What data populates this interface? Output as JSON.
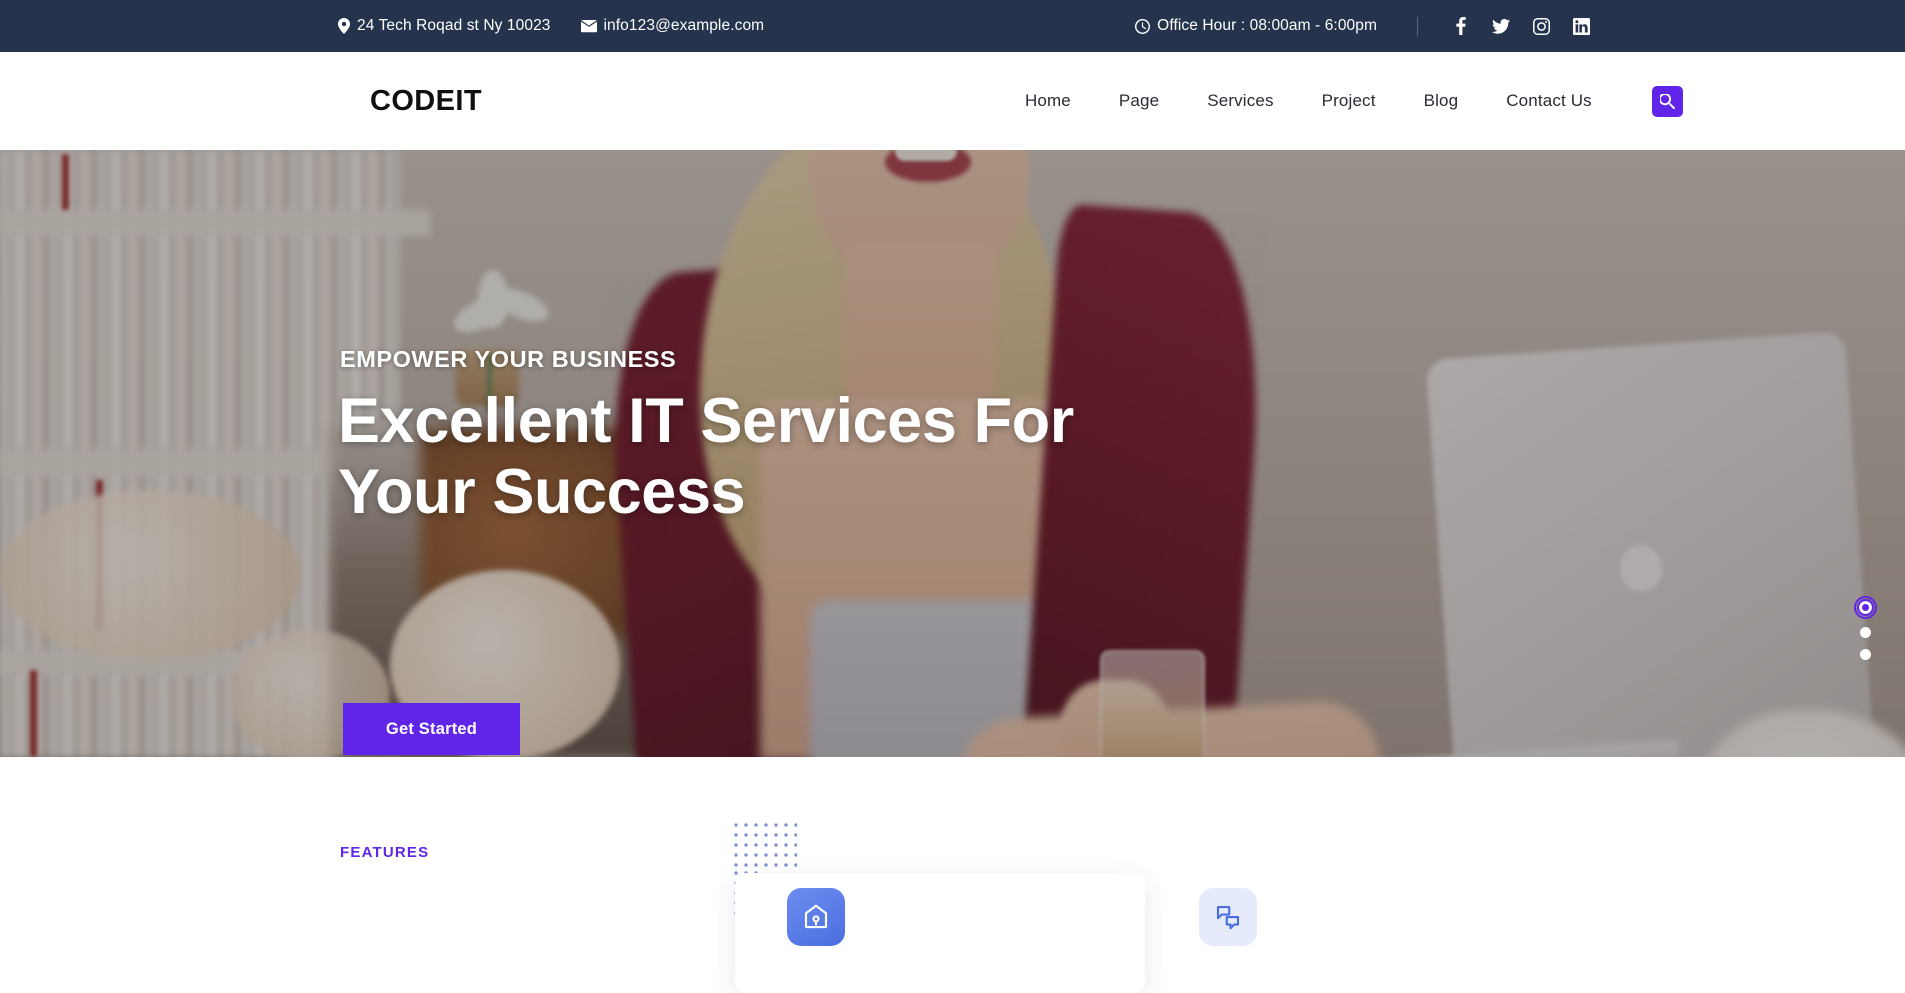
{
  "topbar": {
    "address": "24 Tech Roqad st Ny 10023",
    "address_icon": "map-pin-icon",
    "email": "info123@example.com",
    "email_icon": "envelope-icon",
    "office_hour": "Office Hour : 08:00am - 6:00pm",
    "office_hour_icon": "clock-icon",
    "socials": [
      {
        "name": "facebook-icon",
        "label": "Facebook"
      },
      {
        "name": "twitter-icon",
        "label": "Twitter"
      },
      {
        "name": "instagram-icon",
        "label": "Instagram"
      },
      {
        "name": "linkedin-icon",
        "label": "LinkedIn"
      }
    ],
    "background_color": "#26334d"
  },
  "header": {
    "logo": "CODEIT",
    "nav": [
      {
        "label": "Home"
      },
      {
        "label": "Page"
      },
      {
        "label": "Services"
      },
      {
        "label": "Project"
      },
      {
        "label": "Blog"
      },
      {
        "label": "Contact Us"
      }
    ],
    "search_icon": "search-icon",
    "search_button_color": "#6025e8"
  },
  "hero": {
    "eyebrow": "EMPOWER YOUR BUSINESS",
    "title": "Excellent IT Services For Your Success",
    "cta_label": "Get Started",
    "cta_color": "#6025e8",
    "slider_dots": 3,
    "active_dot": 1,
    "active_dot_color": "#6025e8"
  },
  "features": {
    "label": "FEATURES",
    "label_color": "#6025e8",
    "cards": [
      {
        "icon": "home-shield-icon",
        "icon_bg": "#4a6ee0"
      },
      {
        "icon": "chat-bubbles-icon",
        "icon_bg": "#e6ebfb"
      }
    ]
  }
}
